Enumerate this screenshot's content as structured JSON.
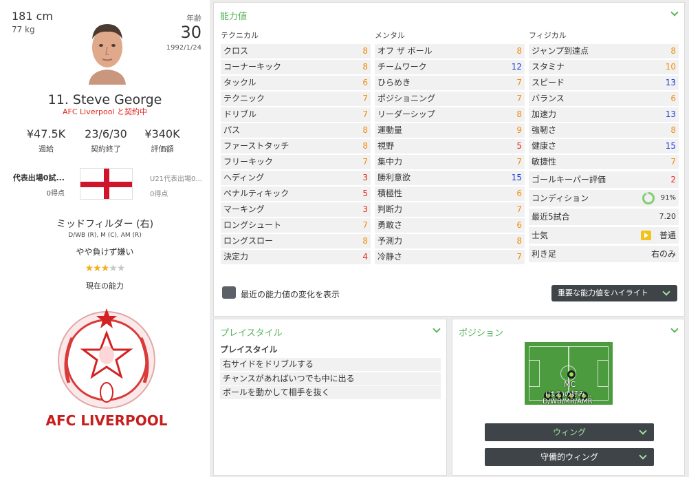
{
  "player": {
    "height": "181 cm",
    "weight": "77 kg",
    "age_label": "年齢",
    "age": "30",
    "dob": "1992/1/24",
    "name": "11. Steve George",
    "contract_status": "AFC Liverpool と契約中",
    "wage_value": "¥47.5K",
    "wage_label": "週給",
    "contract_end_value": "23/6/30",
    "contract_end_label": "契約終了",
    "valuation_value": "¥340K",
    "valuation_label": "評価額",
    "caps_title": "代表出場0試...",
    "caps_goals": "0得点",
    "u21_title": "U21代表出場0...",
    "u21_goals": "0得点",
    "position_main": "ミッドフィルダー (右)",
    "position_detail": "D/WB (R), M (C), AM (R)",
    "personality": "やや負けず嫌い",
    "current_ability_label": "現在の能力",
    "current_ability_stars": 3,
    "club_logo_text": "AFC LIVERPOOL"
  },
  "attributes_panel": {
    "title": "能力値",
    "col_technical": "テクニカル",
    "col_mental": "メンタル",
    "col_physical": "フィジカル",
    "technical": [
      {
        "name": "クロス",
        "value": "8"
      },
      {
        "name": "コーナーキック",
        "value": "8"
      },
      {
        "name": "タックル",
        "value": "6"
      },
      {
        "name": "テクニック",
        "value": "7"
      },
      {
        "name": "ドリブル",
        "value": "7"
      },
      {
        "name": "パス",
        "value": "8"
      },
      {
        "name": "ファーストタッチ",
        "value": "8"
      },
      {
        "name": "フリーキック",
        "value": "7"
      },
      {
        "name": "ヘディング",
        "value": "3"
      },
      {
        "name": "ペナルティキック",
        "value": "5"
      },
      {
        "name": "マーキング",
        "value": "3"
      },
      {
        "name": "ロングシュート",
        "value": "7"
      },
      {
        "name": "ロングスロー",
        "value": "8"
      },
      {
        "name": "決定力",
        "value": "4"
      }
    ],
    "mental": [
      {
        "name": "オフ ザ ボール",
        "value": "8"
      },
      {
        "name": "チームワーク",
        "value": "12"
      },
      {
        "name": "ひらめき",
        "value": "7"
      },
      {
        "name": "ポジショニング",
        "value": "7"
      },
      {
        "name": "リーダーシップ",
        "value": "8"
      },
      {
        "name": "運動量",
        "value": "9"
      },
      {
        "name": "視野",
        "value": "5"
      },
      {
        "name": "集中力",
        "value": "7"
      },
      {
        "name": "勝利意欲",
        "value": "15"
      },
      {
        "name": "積極性",
        "value": "6"
      },
      {
        "name": "判断力",
        "value": "7"
      },
      {
        "name": "勇敢さ",
        "value": "6"
      },
      {
        "name": "予測力",
        "value": "8"
      },
      {
        "name": "冷静さ",
        "value": "7"
      }
    ],
    "physical": [
      {
        "name": "ジャンプ到達点",
        "value": "8"
      },
      {
        "name": "スタミナ",
        "value": "10"
      },
      {
        "name": "スピード",
        "value": "13"
      },
      {
        "name": "バランス",
        "value": "6"
      },
      {
        "name": "加速力",
        "value": "13"
      },
      {
        "name": "強靭さ",
        "value": "8"
      },
      {
        "name": "健康さ",
        "value": "15"
      },
      {
        "name": "敏捷性",
        "value": "7"
      }
    ],
    "goalkeeper_rating_label": "ゴールキーパー評価",
    "goalkeeper_rating_value": "2",
    "condition_label": "コンディション",
    "condition_value": "91%",
    "condition_fraction": 0.91,
    "last5_label": "最近5試合",
    "last5_value": "7.20",
    "morale_label": "士気",
    "morale_value": "普通",
    "foot_label": "利き足",
    "foot_value": "右のみ",
    "show_changes_label": "最近の能力値の変化を表示",
    "highlight_button": "重要な能力値をハイライト"
  },
  "playstyle_panel": {
    "title": "プレイスタイル",
    "heading": "プレイスタイル",
    "items": [
      "右サイドをドリブルする",
      "チャンスがあればいつでも中に出る",
      "ボールを動かして相手を抜く"
    ]
  },
  "position_panel": {
    "title": "ポジション",
    "pitch_label_mc": "MC",
    "pitch_label_pref": "(はえ)の好み...",
    "pitch_label_bottom": "D/WB/MR/AMR",
    "role_button_1": "ウィング",
    "role_button_2": "守備的ウィング"
  },
  "colors": {
    "accent_green": "#58b35e",
    "value_red": "#e32b1d",
    "value_orange": "#f28c0a",
    "value_blue": "#1b3bd9",
    "dark_button": "#3f4449"
  }
}
